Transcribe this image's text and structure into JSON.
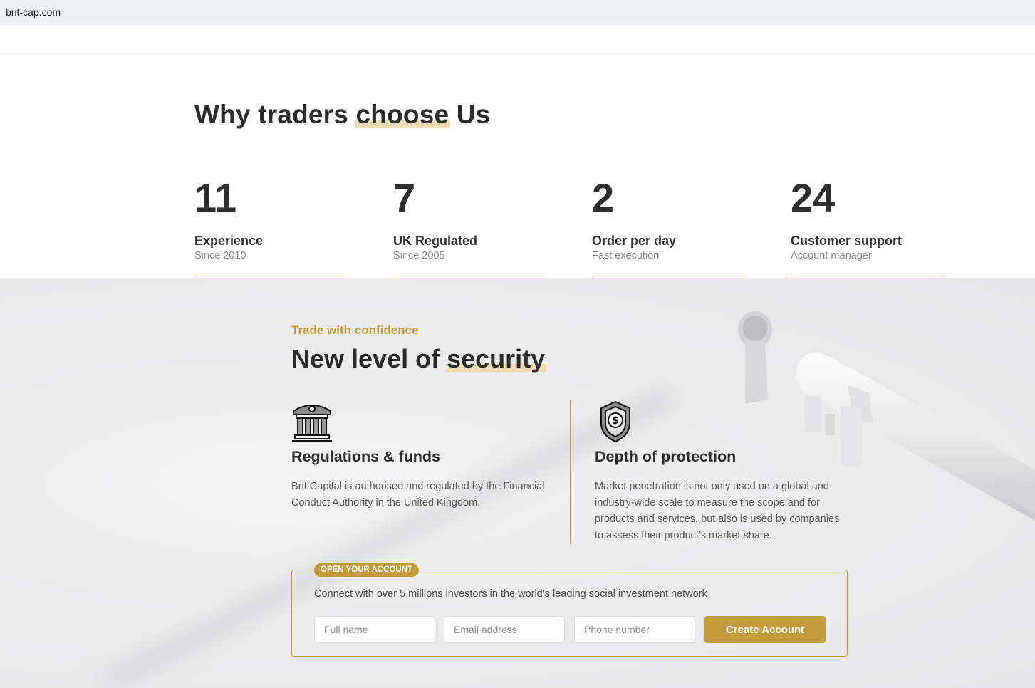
{
  "browser": {
    "url": "brit-cap.com"
  },
  "why": {
    "title_before": "Why traders ",
    "title_highlight": "choose",
    "title_after": " Us",
    "stats": [
      {
        "number": "11",
        "label": "Experience",
        "sub": "Since 2010"
      },
      {
        "number": "7",
        "label": "UK Regulated",
        "sub": "Since 2005"
      },
      {
        "number": "2",
        "label": "Order per day",
        "sub": "Fast execution"
      },
      {
        "number": "24",
        "label": "Customer support",
        "sub": "Account manager"
      }
    ]
  },
  "security": {
    "tagline": "Trade with confidence",
    "title_before": "New level of ",
    "title_highlight": "security",
    "features": [
      {
        "icon": "bank-building-icon",
        "title": "Regulations & funds",
        "text": "Brit Capital is authorised and regulated by the Financial Conduct Authority in the United Kingdom."
      },
      {
        "icon": "shield-dollar-icon",
        "title": "Depth of protection",
        "text": "Market penetration is not only used on a global and industry-wide scale to measure the scope and for products and services, but also is used by companies to assess their product’s market share."
      }
    ]
  },
  "account": {
    "badge": "OPEN YOUR ACCOUNT",
    "text": "Connect with over 5 millions investors in the world’s leading social investment network",
    "fullname_placeholder": "Full name",
    "email_placeholder": "Email address",
    "phone_placeholder": "Phone number",
    "submit_label": "Create Account"
  },
  "colors": {
    "accent": "#c29a3a",
    "highlight": "#ecdcb4",
    "text": "#2b2b2b",
    "muted": "#8b8b8b"
  }
}
